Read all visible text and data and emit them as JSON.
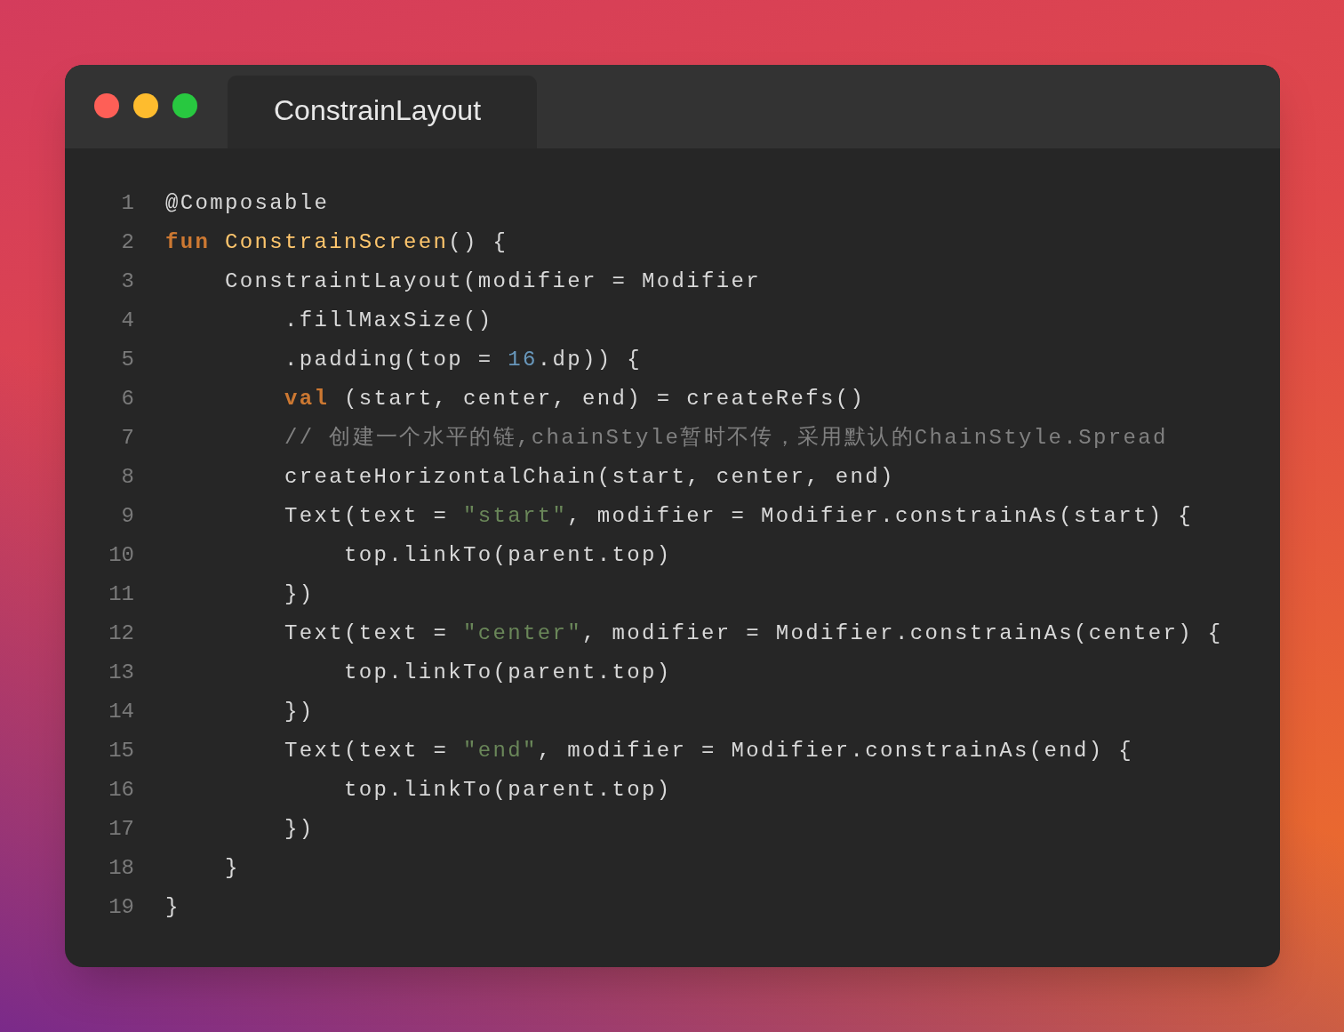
{
  "window": {
    "tab": {
      "title": "ConstrainLayout"
    }
  },
  "code": {
    "lines": [
      {
        "number": "1",
        "tokens": [
          {
            "kind": "annotation",
            "text": "@Composable"
          }
        ]
      },
      {
        "number": "2",
        "tokens": [
          {
            "kind": "keyword",
            "text": "fun "
          },
          {
            "kind": "function",
            "text": "ConstrainScreen"
          },
          {
            "kind": "plain",
            "text": "() {"
          }
        ]
      },
      {
        "number": "3",
        "tokens": [
          {
            "kind": "plain",
            "text": "    ConstraintLayout(modifier = Modifier"
          }
        ]
      },
      {
        "number": "4",
        "tokens": [
          {
            "kind": "plain",
            "text": "        .fillMaxSize()"
          }
        ]
      },
      {
        "number": "5",
        "tokens": [
          {
            "kind": "plain",
            "text": "        .padding(top = "
          },
          {
            "kind": "number",
            "text": "16"
          },
          {
            "kind": "plain",
            "text": ".dp)) {"
          }
        ]
      },
      {
        "number": "6",
        "tokens": [
          {
            "kind": "keyword",
            "text": "        val"
          },
          {
            "kind": "plain",
            "text": " (start, center, end) = createRefs()"
          }
        ]
      },
      {
        "number": "7",
        "tokens": [
          {
            "kind": "comment",
            "text": "        // 创建一个水平的链,chainStyle暂时不传，采用默认的ChainStyle.Spread"
          }
        ]
      },
      {
        "number": "8",
        "tokens": [
          {
            "kind": "plain",
            "text": "        createHorizontalChain(start, center, end)"
          }
        ]
      },
      {
        "number": "9",
        "tokens": [
          {
            "kind": "plain",
            "text": "        Text(text = "
          },
          {
            "kind": "string",
            "text": "\"start\""
          },
          {
            "kind": "plain",
            "text": ", modifier = Modifier.constrainAs(start) {"
          }
        ]
      },
      {
        "number": "10",
        "tokens": [
          {
            "kind": "plain",
            "text": "            top.linkTo(parent.top)"
          }
        ]
      },
      {
        "number": "11",
        "tokens": [
          {
            "kind": "plain",
            "text": "        })"
          }
        ]
      },
      {
        "number": "12",
        "tokens": [
          {
            "kind": "plain",
            "text": "        Text(text = "
          },
          {
            "kind": "string",
            "text": "\"center\""
          },
          {
            "kind": "plain",
            "text": ", modifier = Modifier.constrainAs(center) {"
          }
        ]
      },
      {
        "number": "13",
        "tokens": [
          {
            "kind": "plain",
            "text": "            top.linkTo(parent.top)"
          }
        ]
      },
      {
        "number": "14",
        "tokens": [
          {
            "kind": "plain",
            "text": "        })"
          }
        ]
      },
      {
        "number": "15",
        "tokens": [
          {
            "kind": "plain",
            "text": "        Text(text = "
          },
          {
            "kind": "string",
            "text": "\"end\""
          },
          {
            "kind": "plain",
            "text": ", modifier = Modifier.constrainAs(end) {"
          }
        ]
      },
      {
        "number": "16",
        "tokens": [
          {
            "kind": "plain",
            "text": "            top.linkTo(parent.top)"
          }
        ]
      },
      {
        "number": "17",
        "tokens": [
          {
            "kind": "plain",
            "text": "        })"
          }
        ]
      },
      {
        "number": "18",
        "tokens": [
          {
            "kind": "plain",
            "text": "    }"
          }
        ]
      },
      {
        "number": "19",
        "tokens": [
          {
            "kind": "plain",
            "text": "}"
          }
        ]
      }
    ]
  }
}
